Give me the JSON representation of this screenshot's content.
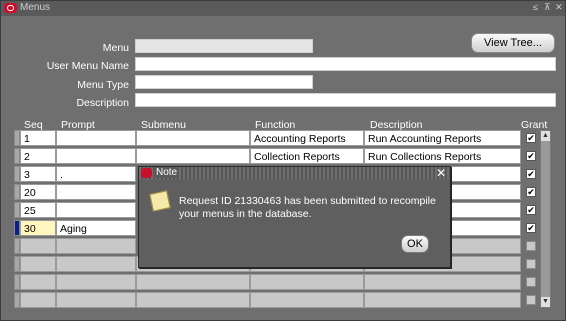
{
  "window": {
    "title": "Menus",
    "controls": [
      "≤",
      "⊼",
      "✕"
    ]
  },
  "header": {
    "view_tree_label": "View Tree...",
    "fields": [
      {
        "label": "Menu",
        "value": ""
      },
      {
        "label": "User Menu Name",
        "value": ""
      },
      {
        "label": "Menu Type",
        "value": ""
      },
      {
        "label": "Description",
        "value": ""
      }
    ]
  },
  "grid": {
    "columns": {
      "seq": "Seq",
      "prompt": "Prompt",
      "submenu": "Submenu",
      "function": "Function",
      "description": "Description",
      "grant": "Grant"
    },
    "rows": [
      {
        "seq": "1",
        "prompt": "",
        "submenu": "",
        "function": "Accounting Reports",
        "description": "Run Accounting Reports",
        "grant": true
      },
      {
        "seq": "2",
        "prompt": "",
        "submenu": "",
        "function": "Collection Reports",
        "description": "Run Collections Reports",
        "grant": true
      },
      {
        "seq": "3",
        "prompt": ".",
        "submenu": "",
        "function": "",
        "description": "",
        "grant": true
      },
      {
        "seq": "20",
        "prompt": "",
        "submenu": "",
        "function": "",
        "description": "",
        "grant": true
      },
      {
        "seq": "25",
        "prompt": "",
        "submenu": "",
        "function": "",
        "description": "",
        "grant": true
      },
      {
        "seq": "30",
        "prompt": "Aging",
        "submenu": "",
        "function": "",
        "description": "",
        "grant": true
      }
    ],
    "empty_rows": 4
  },
  "dialog": {
    "title": "Note",
    "message": "Request ID  21330463 has been submitted to recompile your menus in the database.",
    "ok_label": "OK",
    "close_glyph": "✕"
  },
  "colors": {
    "window_bg": "#6f6f6f",
    "titlebar": "#5a5a5a",
    "current_row": "#0a1f8c",
    "oracle_red": "#c8102e"
  }
}
